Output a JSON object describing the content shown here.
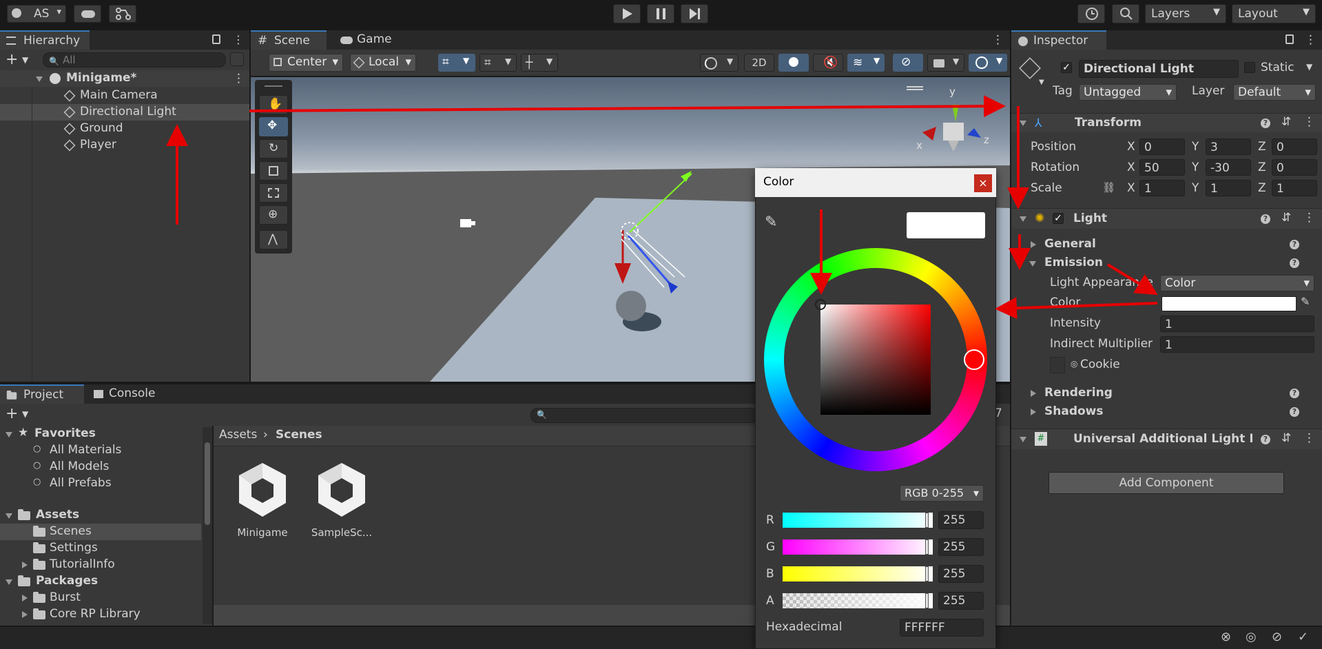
{
  "toolbar": {
    "account": "AS",
    "layers": "Layers",
    "layout": "Layout"
  },
  "hierarchy": {
    "title": "Hierarchy",
    "search_placeholder": "All",
    "scene": "Minigame*",
    "items": [
      "Main Camera",
      "Directional Light",
      "Ground",
      "Player"
    ]
  },
  "scene_view": {
    "tab_scene": "Scene",
    "tab_game": "Game",
    "pivot": "Center",
    "space": "Local",
    "mode_2d": "2D",
    "gizmo_x": "x",
    "gizmo_y": "y",
    "gizmo_z": "z"
  },
  "project": {
    "tab_project": "Project",
    "tab_console": "Console",
    "favorites_label": "Favorites",
    "favorites": [
      "All Materials",
      "All Models",
      "All Prefabs"
    ],
    "assets_label": "Assets",
    "assets": [
      "Scenes",
      "Settings",
      "TutorialInfo"
    ],
    "packages_label": "Packages",
    "packages": [
      "Burst",
      "Core RP Library"
    ],
    "breadcrumb_root": "Assets",
    "breadcrumb_current": "Scenes",
    "files": [
      "Minigame",
      "SampleSc..."
    ],
    "count_badge": "7"
  },
  "color_picker": {
    "title": "Color",
    "mode": "RGB 0-255",
    "channels": [
      {
        "label": "R",
        "value": "255"
      },
      {
        "label": "G",
        "value": "255"
      },
      {
        "label": "B",
        "value": "255"
      },
      {
        "label": "A",
        "value": "255"
      }
    ],
    "hex_label": "Hexadecimal",
    "hex_value": "FFFFFF",
    "swatch_color": "#FFFFFF"
  },
  "inspector": {
    "title": "Inspector",
    "object_name": "Directional Light",
    "static_label": "Static",
    "tag_label": "Tag",
    "tag_value": "Untagged",
    "layer_label": "Layer",
    "layer_value": "Default",
    "transform": {
      "title": "Transform",
      "position_label": "Position",
      "rotation_label": "Rotation",
      "scale_label": "Scale",
      "position": [
        "0",
        "3",
        "0"
      ],
      "rotation": [
        "50",
        "-30",
        "0"
      ],
      "scale": [
        "1",
        "1",
        "1"
      ],
      "axis_x": "X",
      "axis_y": "Y",
      "axis_z": "Z"
    },
    "light": {
      "title": "Light",
      "general": "General",
      "emission": "Emission",
      "light_appearance_label": "Light Appearance",
      "light_appearance_value": "Color",
      "color_label": "Color",
      "intensity_label": "Intensity",
      "intensity_value": "1",
      "indirect_label": "Indirect Multiplier",
      "indirect_value": "1",
      "cookie_label": "Cookie",
      "rendering": "Rendering",
      "shadows": "Shadows"
    },
    "additional_title": "Universal Additional Light Da",
    "add_component": "Add Component"
  },
  "colors": {
    "annotation": "#e60000",
    "selection": "#3a79bb"
  }
}
